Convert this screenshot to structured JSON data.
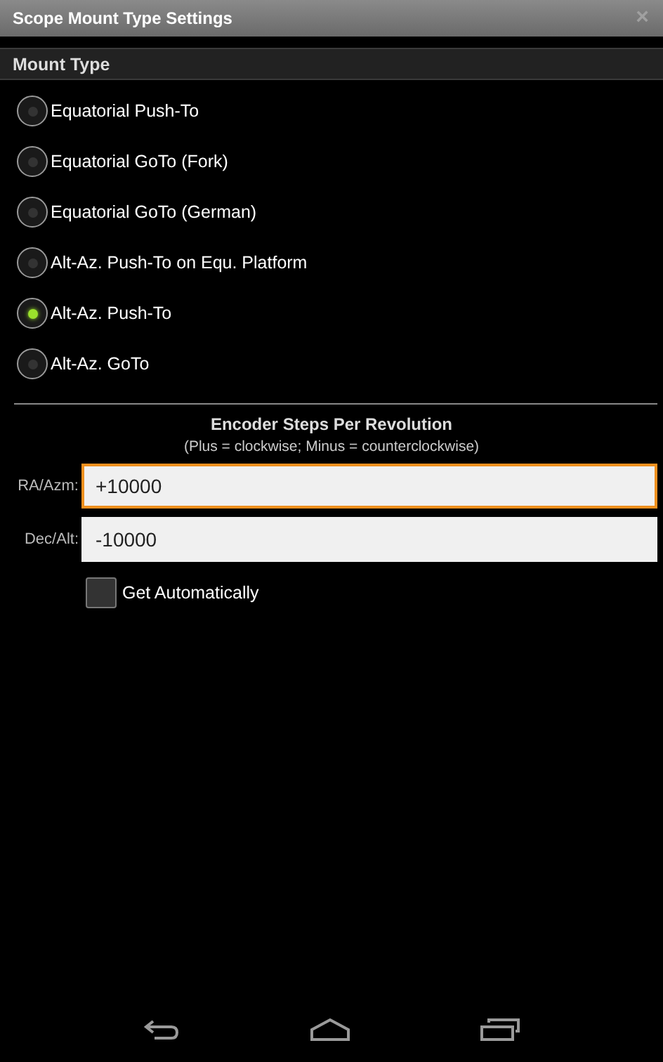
{
  "window": {
    "title": "Scope Mount Type Settings",
    "close": "×"
  },
  "section": {
    "title": "Mount Type"
  },
  "mount_types": [
    {
      "label": "Equatorial Push-To",
      "selected": false
    },
    {
      "label": "Equatorial GoTo (Fork)",
      "selected": false
    },
    {
      "label": "Equatorial GoTo (German)",
      "selected": false
    },
    {
      "label": "Alt-Az. Push-To on Equ. Platform",
      "selected": false
    },
    {
      "label": "Alt-Az. Push-To",
      "selected": true
    },
    {
      "label": "Alt-Az. GoTo",
      "selected": false
    }
  ],
  "encoder": {
    "title": "Encoder Steps Per Revolution",
    "subtitle": "(Plus = clockwise; Minus = counterclockwise)",
    "fields": [
      {
        "label": "RA/Azm:",
        "value": "+10000",
        "focused": true
      },
      {
        "label": "Dec/Alt:",
        "value": "-10000",
        "focused": false
      }
    ],
    "auto": {
      "label": "Get Automatically",
      "checked": false
    }
  }
}
